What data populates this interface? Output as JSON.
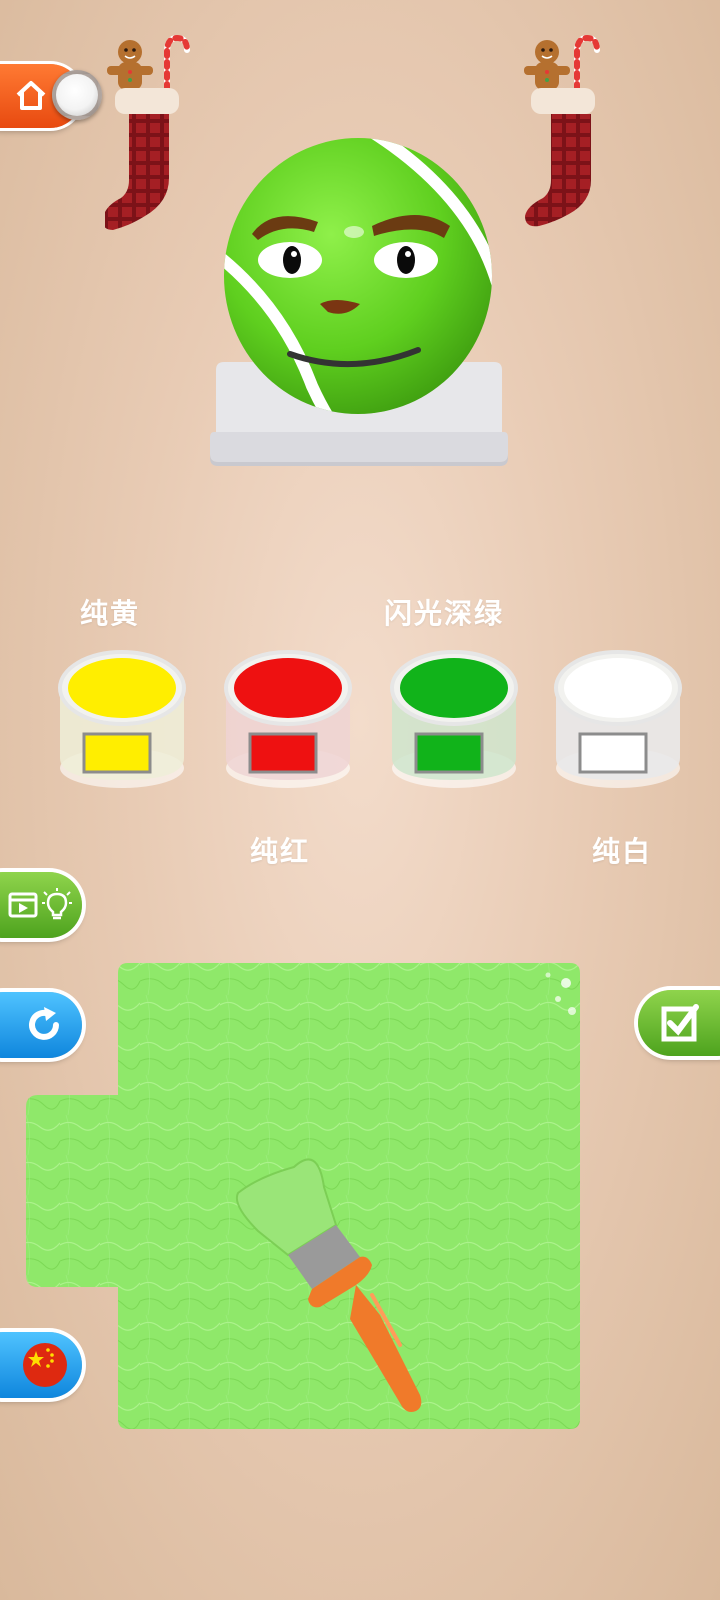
{
  "paints": [
    {
      "label": "纯黄",
      "color": "#ffee00"
    },
    {
      "label": "纯红",
      "color": "#ee1111"
    },
    {
      "label": "闪光深绿",
      "color": "#11b31a"
    },
    {
      "label": "纯白",
      "color": "#ffffff"
    }
  ],
  "buttons": {
    "home_icon": "home-icon",
    "hint_icons": [
      "video-icon",
      "lightbulb-icon"
    ],
    "restart_icon": "restart-icon",
    "check_icon": "checkbox-icon",
    "language_icon": "china-flag-icon",
    "language_flag_colors": [
      "#de2910",
      "#ffde00"
    ]
  },
  "colors": {
    "ball": "#6fdc2a",
    "canvas_paint": "#8fe86a",
    "brush_handle": "#f07a2a",
    "background": "#efd6c2"
  }
}
